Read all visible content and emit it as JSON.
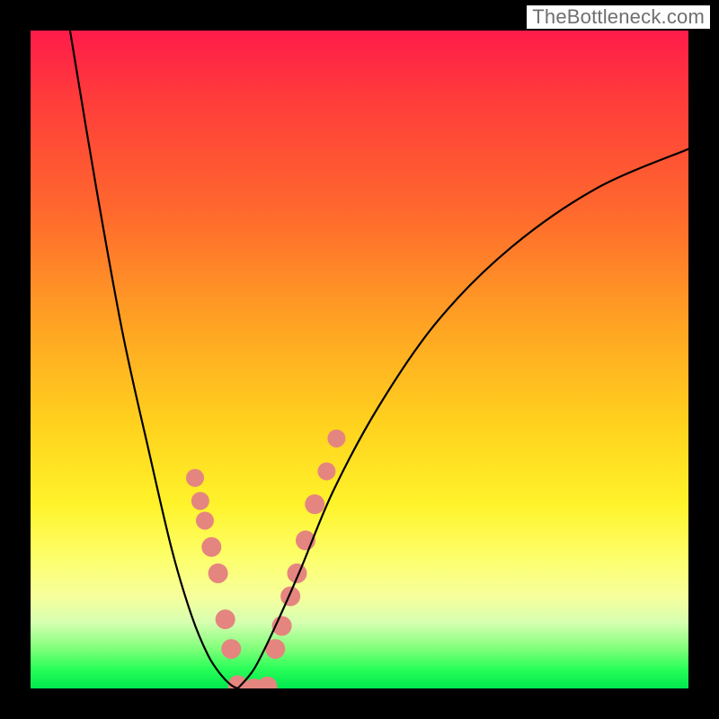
{
  "watermark": "TheBottleneck.com",
  "chart_data": {
    "type": "line",
    "title": "",
    "xlabel": "",
    "ylabel": "",
    "xlim": [
      0,
      1
    ],
    "ylim": [
      0,
      1
    ],
    "series": [
      {
        "name": "left-curve",
        "x": [
          0.06,
          0.1,
          0.14,
          0.18,
          0.215,
          0.245,
          0.27,
          0.29,
          0.305,
          0.315
        ],
        "y": [
          1.0,
          0.76,
          0.54,
          0.36,
          0.21,
          0.11,
          0.05,
          0.02,
          0.005,
          0.0
        ]
      },
      {
        "name": "right-curve",
        "x": [
          0.315,
          0.34,
          0.37,
          0.41,
          0.46,
          0.53,
          0.62,
          0.73,
          0.86,
          1.0
        ],
        "y": [
          0.0,
          0.03,
          0.09,
          0.18,
          0.3,
          0.43,
          0.56,
          0.67,
          0.76,
          0.82
        ]
      }
    ],
    "markers": [
      {
        "name": "left-markers",
        "x": [
          0.25,
          0.258,
          0.265,
          0.275,
          0.285,
          0.296,
          0.305,
          0.315
        ],
        "y": [
          0.32,
          0.285,
          0.255,
          0.215,
          0.175,
          0.105,
          0.06,
          0.005
        ],
        "r": [
          10,
          10,
          10,
          11,
          11,
          11,
          11,
          11
        ]
      },
      {
        "name": "bottom-markers",
        "x": [
          0.32,
          0.34,
          0.36
        ],
        "y": [
          0.0,
          0.0,
          0.003
        ],
        "r": [
          11,
          11,
          11
        ]
      },
      {
        "name": "right-markers",
        "x": [
          0.372,
          0.382,
          0.395,
          0.405,
          0.418,
          0.432,
          0.45,
          0.465
        ],
        "y": [
          0.06,
          0.095,
          0.14,
          0.175,
          0.225,
          0.28,
          0.33,
          0.38
        ],
        "r": [
          11,
          11,
          11,
          11,
          11,
          11,
          10,
          10
        ]
      }
    ],
    "marker_color": "#e5857f",
    "curve_color": "#000000",
    "curve_width": 2.2
  }
}
